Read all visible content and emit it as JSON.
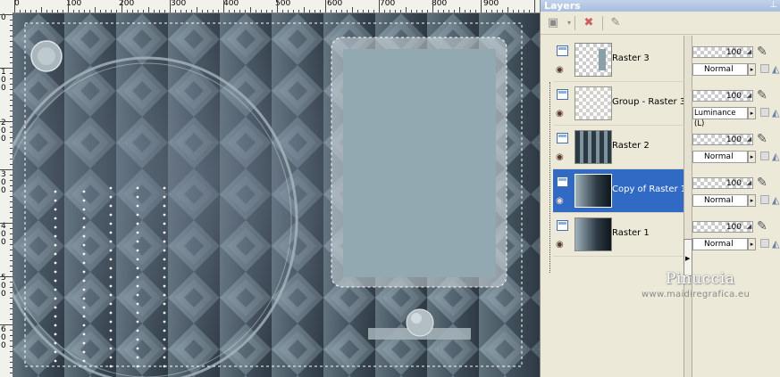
{
  "ruler": {
    "top_labels": [
      "0",
      "100",
      "200",
      "300",
      "400",
      "500",
      "600",
      "700",
      "800",
      "900"
    ],
    "left_labels": [
      "0",
      "1 0 0",
      "2 0 0",
      "3 0 0",
      "4 0 0",
      "5 0 0",
      "6 0 0"
    ]
  },
  "palette": {
    "title": "Layers",
    "pin_icon": "pin-icon",
    "toolbar": {
      "new_layer_icon": "new-raster-layer-icon",
      "delete_icon": "delete-layer-icon",
      "edit_icon": "edit-selection-icon"
    },
    "layers": [
      {
        "name": "Raster 3",
        "opacity": "100",
        "blend": "Normal",
        "thumb": "checker-strip",
        "selected": false
      },
      {
        "name": "Group - Raster 3",
        "opacity": "100",
        "blend": "Luminance (L)",
        "thumb": "checker-pattern",
        "selected": false
      },
      {
        "name": "Raster 2",
        "opacity": "100",
        "blend": "Normal",
        "thumb": "dark-pattern",
        "selected": false
      },
      {
        "name": "Copy of Raster 1",
        "opacity": "100",
        "blend": "Normal",
        "thumb": "gradient",
        "selected": true
      },
      {
        "name": "Raster 1",
        "opacity": "100",
        "blend": "Normal",
        "thumb": "gradient",
        "selected": false
      }
    ],
    "watermark_name": "Pinuccia",
    "watermark_url": "www.maidiregrafica.eu"
  },
  "colors": {
    "selection": "#316ac5",
    "canvas_light": "#93a9b1",
    "canvas_dark": "#1f2a33"
  }
}
